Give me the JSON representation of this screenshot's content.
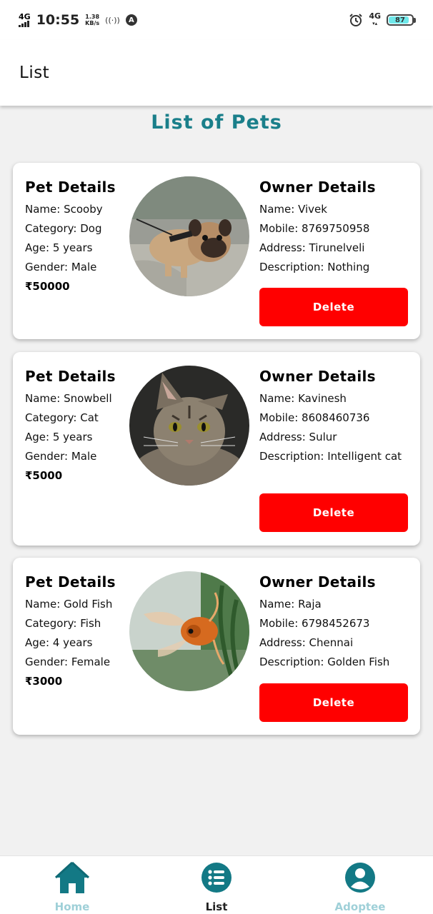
{
  "status_bar": {
    "network_left": "4G",
    "time": "10:55",
    "speed_value": "1.38",
    "speed_unit": "KB/s",
    "network_right": "4G",
    "battery": "87",
    "battery_level": 0.87
  },
  "header": {
    "title": "List"
  },
  "page": {
    "title": "List of Pets"
  },
  "pets": [
    {
      "pet_heading": "Pet Details",
      "name": "Name: Scooby",
      "category": "Category: Dog",
      "age": "Age: 5 years",
      "gender": "Gender: Male",
      "price": "₹50000",
      "owner_heading": "Owner Details",
      "owner_name": "Name: Vivek",
      "mobile": "Mobile: 8769750958",
      "address": "Address: Tirunelveli",
      "description": "Description: Nothing",
      "delete_label": "Delete",
      "photo_icon": "dog-photo"
    },
    {
      "pet_heading": "Pet Details",
      "name": "Name: Snowbell",
      "category": "Category: Cat",
      "age": "Age: 5 years",
      "gender": "Gender: Male",
      "price": "₹5000",
      "owner_heading": "Owner Details",
      "owner_name": "Name: Kavinesh",
      "mobile": "Mobile: 8608460736",
      "address": "Address: Sulur",
      "description": "Description: Intelligent cat",
      "delete_label": "Delete",
      "photo_icon": "cat-photo"
    },
    {
      "pet_heading": "Pet Details",
      "name": "Name: Gold Fish",
      "category": "Category: Fish",
      "age": "Age: 4 years",
      "gender": "Gender: Female",
      "price": "₹3000",
      "owner_heading": "Owner Details",
      "owner_name": "Name: Raja",
      "mobile": "Mobile: 6798452673",
      "address": "Address: Chennai",
      "description": "Description: Golden Fish",
      "delete_label": "Delete",
      "photo_icon": "fish-photo"
    }
  ],
  "bottom_nav": {
    "home": {
      "label": "Home",
      "icon": "home-icon"
    },
    "list": {
      "label": "List",
      "icon": "list-icon",
      "active": true
    },
    "adoptee": {
      "label": "Adoptee",
      "icon": "person-icon"
    }
  },
  "colors": {
    "accent": "#1a7f8a",
    "delete": "#ff0000",
    "inactive_nav": "#9fd0d8",
    "background": "#f1f1f1"
  }
}
